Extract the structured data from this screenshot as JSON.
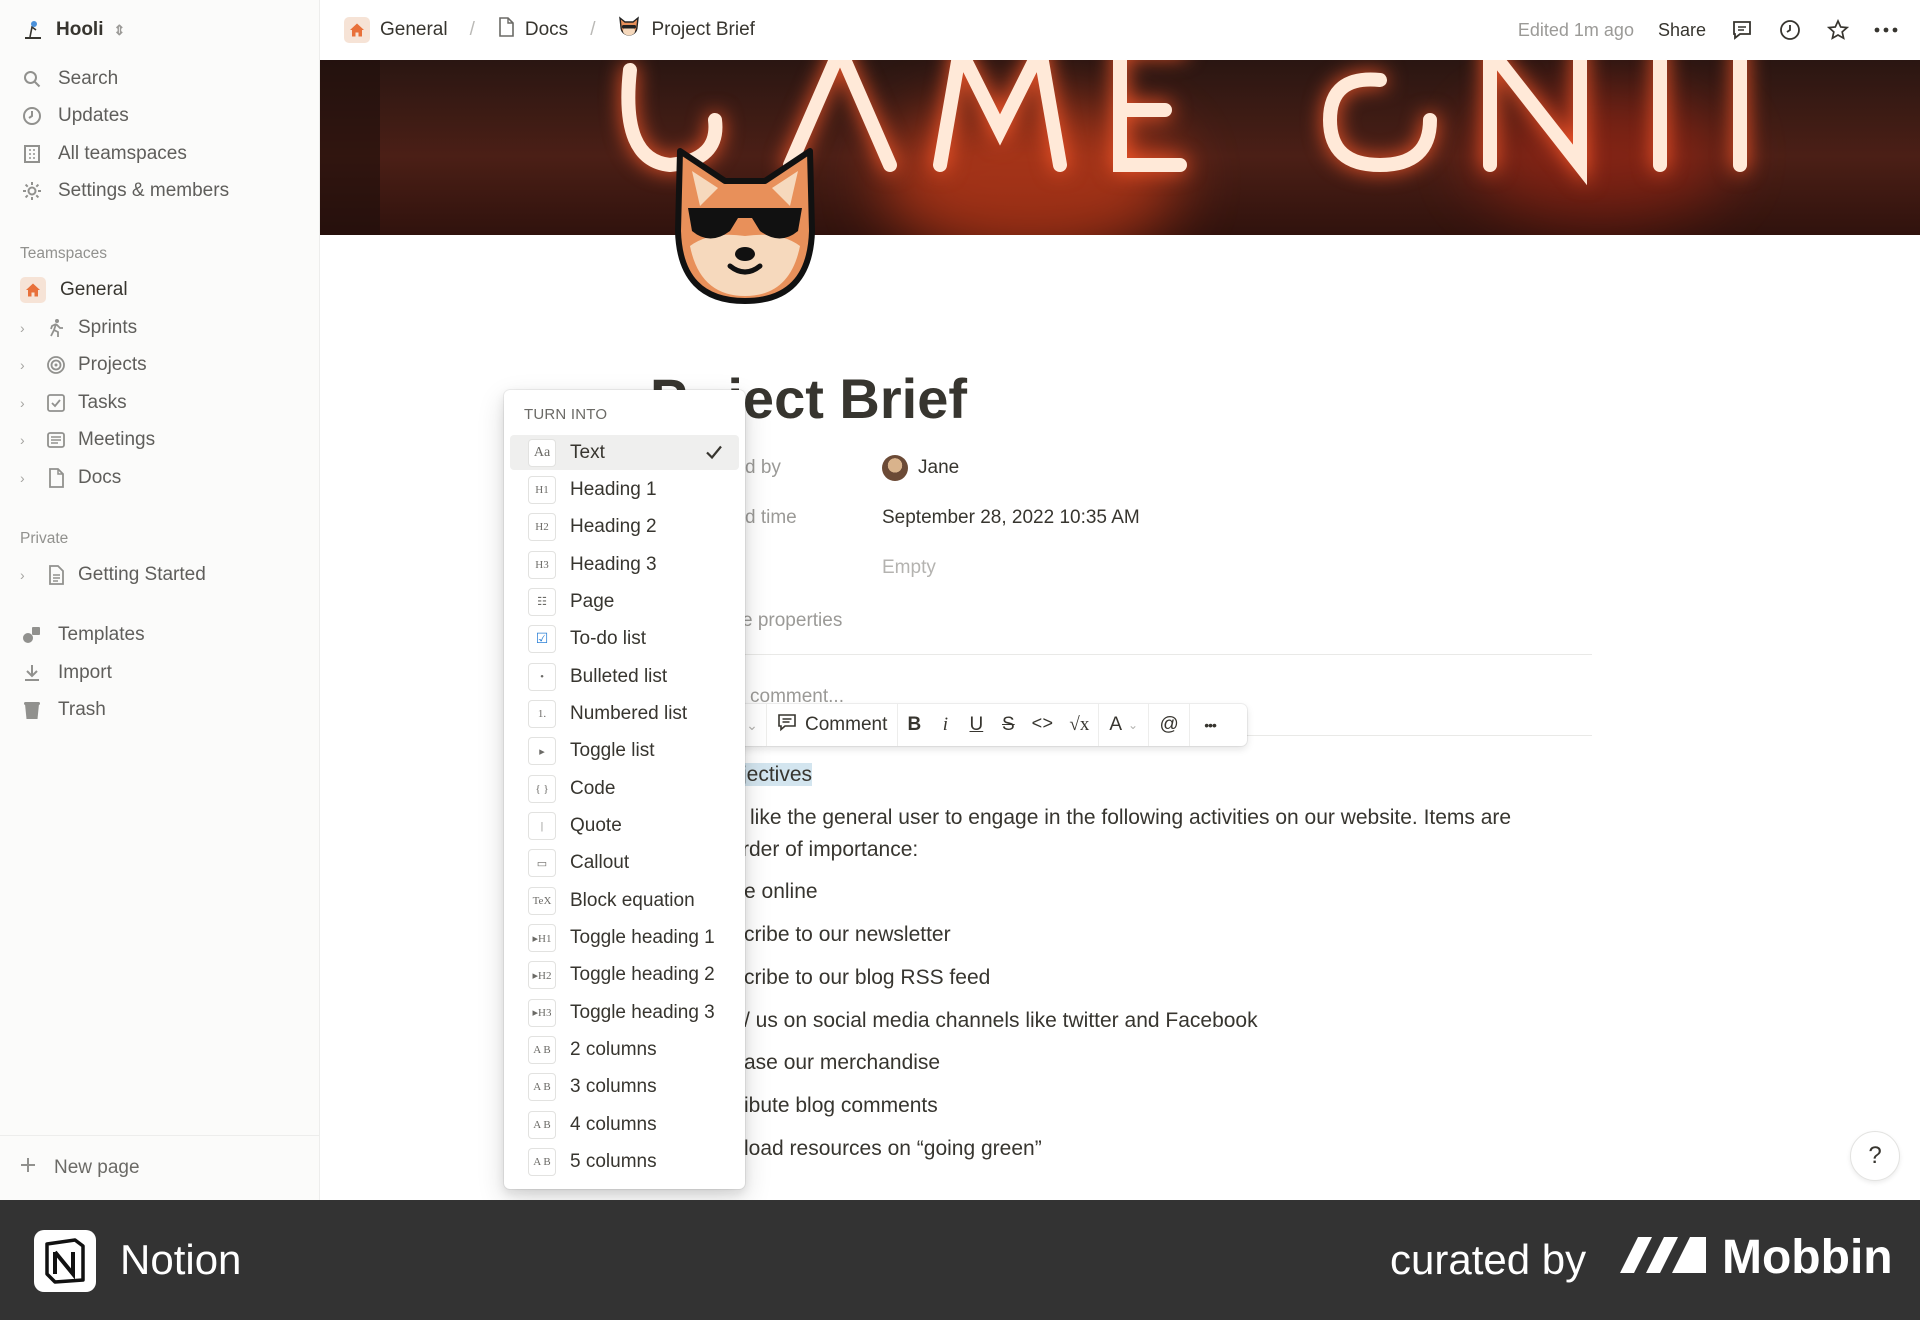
{
  "sidebar": {
    "workspace": "Hooli",
    "nav": [
      {
        "label": "Search",
        "icon": "search-icon"
      },
      {
        "label": "Updates",
        "icon": "clock-icon"
      },
      {
        "label": "All teamspaces",
        "icon": "building-icon"
      },
      {
        "label": "Settings & members",
        "icon": "gear-icon"
      }
    ],
    "teamspaces_header": "Teamspaces",
    "general": "General",
    "teams": [
      {
        "label": "Sprints",
        "icon": "runner-icon"
      },
      {
        "label": "Projects",
        "icon": "target-icon"
      },
      {
        "label": "Tasks",
        "icon": "checkbox-icon"
      },
      {
        "label": "Meetings",
        "icon": "notes-icon"
      },
      {
        "label": "Docs",
        "icon": "page-icon"
      }
    ],
    "private_header": "Private",
    "private_item": "Getting Started",
    "tools": [
      {
        "label": "Templates",
        "icon": "shapes-icon"
      },
      {
        "label": "Import",
        "icon": "download-icon"
      },
      {
        "label": "Trash",
        "icon": "trash-icon"
      }
    ],
    "new_page": "New page"
  },
  "topbar": {
    "crumbs": [
      "General",
      "Docs",
      "Project Brief"
    ],
    "edited": "Edited 1m ago",
    "share": "Share"
  },
  "page": {
    "title_visible": "ject Brief",
    "title_partial": "P",
    "properties": [
      {
        "label": "d by",
        "value": "Jane"
      },
      {
        "label": "d time",
        "value": "September 28, 2022 10:35 AM"
      },
      {
        "label": "",
        "value": "Empty"
      }
    ],
    "more_props": "e properties",
    "comment_placeholder": "comment...",
    "heading": "jectives",
    "para1": "like the general user to engage in the following activities on our website. Items are",
    "para2": "rder of importance:",
    "list": [
      "e online",
      "cribe to our newsletter",
      "cribe to our blog RSS feed",
      "/ us on social media channels like twitter and Facebook",
      "ase our merchandise",
      "ibute blog comments",
      "load resources on “going green”"
    ]
  },
  "menu": {
    "header": "TURN INTO",
    "items": [
      {
        "label": "Text",
        "icon": "Aa",
        "selected": true
      },
      {
        "label": "Heading 1",
        "icon": "H1"
      },
      {
        "label": "Heading 2",
        "icon": "H2"
      },
      {
        "label": "Heading 3",
        "icon": "H3"
      },
      {
        "label": "Page",
        "icon": "☷"
      },
      {
        "label": "To-do list",
        "icon": "☑"
      },
      {
        "label": "Bulleted list",
        "icon": "•"
      },
      {
        "label": "Numbered list",
        "icon": "1."
      },
      {
        "label": "Toggle list",
        "icon": "▸"
      },
      {
        "label": "Code",
        "icon": "{ }"
      },
      {
        "label": "Quote",
        "icon": "|"
      },
      {
        "label": "Callout",
        "icon": "▭"
      },
      {
        "label": "Block equation",
        "icon": "TeX"
      },
      {
        "label": "Toggle heading 1",
        "icon": "▸H1"
      },
      {
        "label": "Toggle heading 2",
        "icon": "▸H2"
      },
      {
        "label": "Toggle heading 3",
        "icon": "▸H3"
      },
      {
        "label": "2 columns",
        "icon": "A B"
      },
      {
        "label": "3 columns",
        "icon": "A B"
      },
      {
        "label": "4 columns",
        "icon": "A B"
      },
      {
        "label": "5 columns",
        "icon": "A B"
      }
    ]
  },
  "toolbar": {
    "comment": "Comment",
    "bold": "B",
    "italic": "i",
    "underline": "U",
    "strike": "S",
    "code": "<>",
    "equation": "√x",
    "color": "A",
    "mention": "@",
    "more": "•••"
  },
  "footer": {
    "app": "Notion",
    "curated": "curated by",
    "brand": "Mobbin"
  },
  "help": "?"
}
